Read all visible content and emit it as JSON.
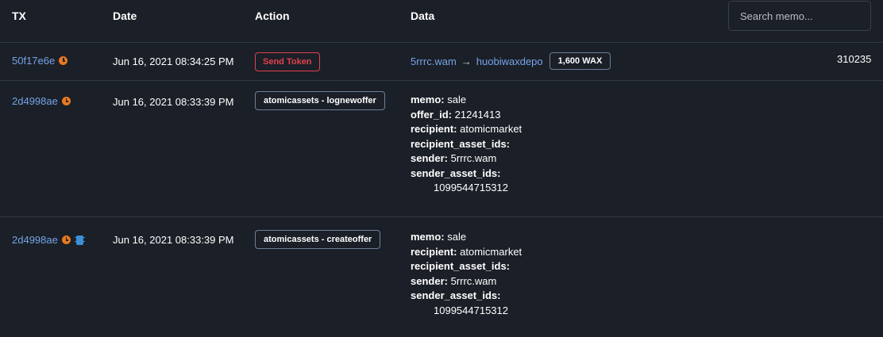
{
  "header": {
    "tx": "TX",
    "date": "Date",
    "action": "Action",
    "data": "Data",
    "search_placeholder": "Search memo..."
  },
  "rows": [
    {
      "tx": "50f17e6e",
      "date": "Jun 16, 2021 08:34:25 PM",
      "action": "Send Token",
      "from": "5rrrc.wam",
      "arrow": "→",
      "to": "huobiwaxdepo",
      "amount": "1,600 WAX",
      "number": "310235"
    },
    {
      "tx": "2d4998ae",
      "date": "Jun 16, 2021 08:33:39 PM",
      "action": "atomicassets - lognewoffer",
      "fields": {
        "memo_label": "memo:",
        "memo": "sale",
        "offer_id_label": "offer_id:",
        "offer_id": "21241413",
        "recipient_label": "recipient:",
        "recipient": "atomicmarket",
        "recipient_asset_ids_label": "recipient_asset_ids:",
        "sender_label": "sender:",
        "sender": "5rrrc.wam",
        "sender_asset_ids_label": "sender_asset_ids:",
        "sender_asset_id_0": "1099544715312"
      }
    },
    {
      "tx": "2d4998ae",
      "date": "Jun 16, 2021 08:33:39 PM",
      "action": "atomicassets - createoffer",
      "fields": {
        "memo_label": "memo:",
        "memo": "sale",
        "recipient_label": "recipient:",
        "recipient": "atomicmarket",
        "recipient_asset_ids_label": "recipient_asset_ids:",
        "sender_label": "sender:",
        "sender": "5rrrc.wam",
        "sender_asset_ids_label": "sender_asset_ids:",
        "sender_asset_id_0": "1099544715312"
      }
    }
  ],
  "icons": {
    "pending": "clock-icon",
    "cpu": "chip-icon"
  },
  "colors": {
    "background": "#1b1f27",
    "link": "#74a5e8",
    "pending": "#e8781e",
    "danger": "#e0424f",
    "chip": "#3d8fd8"
  }
}
